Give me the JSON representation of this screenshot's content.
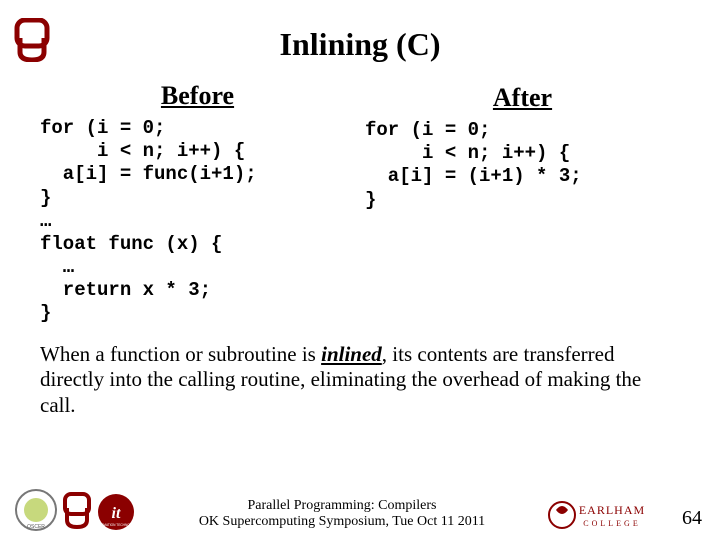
{
  "title": "Inlining (C)",
  "before": {
    "header": "Before",
    "code": "for (i = 0;\n     i < n; i++) {\n  a[i] = func(i+1);\n}\n…\nfloat func (x) {\n  …\n  return x * 3;\n}"
  },
  "after": {
    "header": "After",
    "code": "for (i = 0;\n     i < n; i++) {\n  a[i] = (i+1) * 3;\n}"
  },
  "caption": {
    "pre": "When a function or subroutine is ",
    "term": "inlined",
    "post": ", its contents are transferred directly into the calling routine, eliminating the overhead of making the call."
  },
  "footer": {
    "line1": "Parallel Programming: Compilers",
    "line2": "OK Supercomputing Symposium, Tue Oct 11 2011",
    "page": "64"
  },
  "logos": {
    "ou_top": "OU",
    "oscer": "OSCER",
    "ou_small": "OU",
    "it": "it",
    "earlham": "EARLHAM COLLEGE"
  }
}
